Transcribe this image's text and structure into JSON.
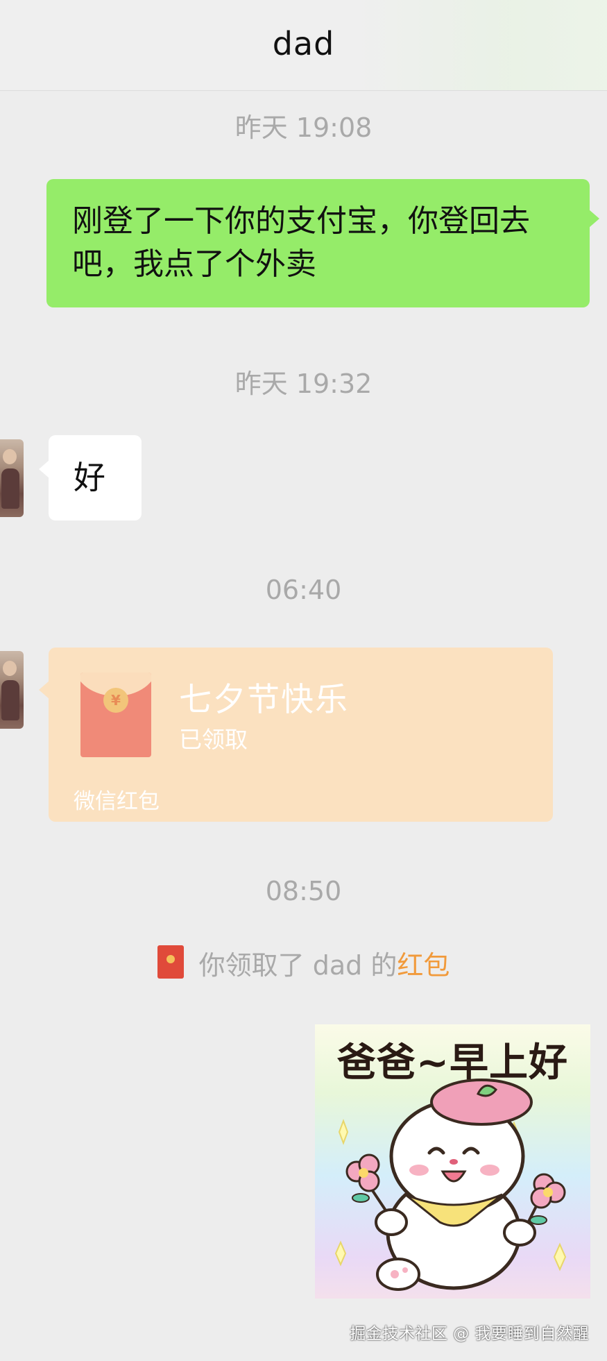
{
  "header": {
    "title": "dad"
  },
  "messages": {
    "timestamp_1": "昨天 19:08",
    "mine_text": "刚登了一下你的支付宝，你登回去吧，我点了个外卖",
    "timestamp_2": "昨天 19:32",
    "theirs_text": "好",
    "timestamp_3": "06:40",
    "red_packet": {
      "greeting": "七夕节快乐",
      "status": "已领取",
      "footer": "微信红包",
      "coin_glyph": "¥"
    },
    "timestamp_4": "08:50",
    "system_notice": {
      "prefix": "你领取了 dad 的",
      "link": "红包"
    },
    "sticker": {
      "text": "爸爸~早上好"
    }
  },
  "watermark": "掘金技术社区 @ 我要睡到自然醒",
  "colors": {
    "background": "#ededed",
    "my_bubble": "#95ec69",
    "their_bubble": "#ffffff",
    "red_packet_opened": "#fbe1c0",
    "timestamp_text": "#a9a9a9",
    "link_orange": "#f19a3b"
  }
}
